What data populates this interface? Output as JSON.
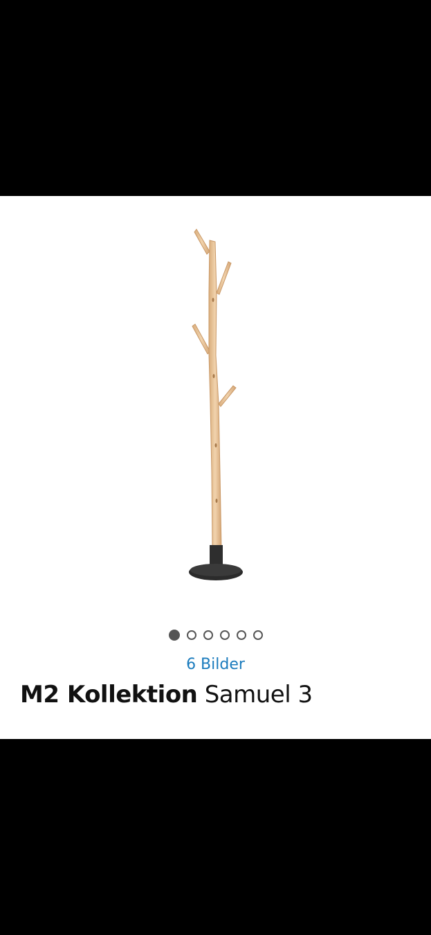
{
  "gallery": {
    "image_icon": "coat-stand-product-image",
    "image_count": 6,
    "active_index": 0,
    "count_label": "6 Bilder"
  },
  "product": {
    "brand": "M2 Kollektion",
    "model": "Samuel 3"
  },
  "colors": {
    "link": "#1a7bbd",
    "dot": "#555555",
    "wood": "#e8c49a",
    "base": "#2b2b2b"
  }
}
